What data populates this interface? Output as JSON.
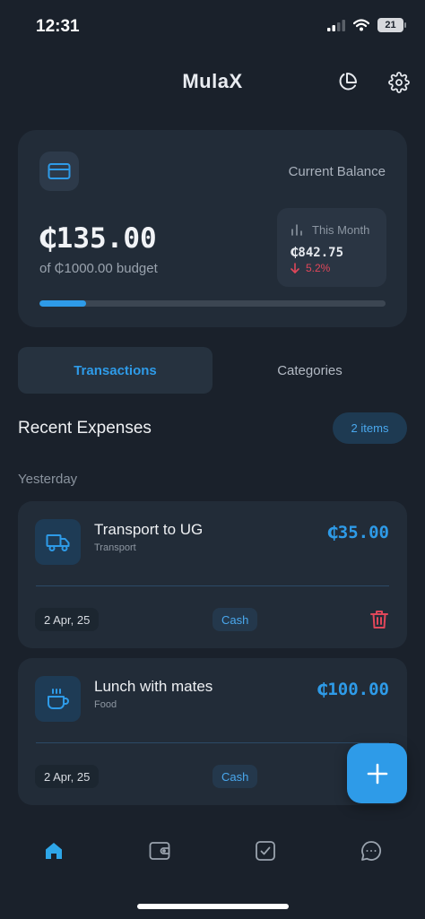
{
  "status": {
    "time": "12:31",
    "battery": "21"
  },
  "header": {
    "title": "MulaX"
  },
  "balance": {
    "label": "Current Balance",
    "amount": "₵135.00",
    "budget_text": "of ₵1000.00 budget",
    "progress_fraction": 0.135,
    "this_month_label": "This Month",
    "this_month_amount": "₵842.75",
    "this_month_change": "5.2%"
  },
  "tabs": [
    {
      "label": "Transactions",
      "active": true
    },
    {
      "label": "Categories",
      "active": false
    }
  ],
  "section": {
    "title": "Recent Expenses",
    "count": "2 items",
    "group_label": "Yesterday"
  },
  "transactions": [
    {
      "title": "Transport to UG",
      "category": "Transport",
      "amount": "₵35.00",
      "date": "2 Apr, 25",
      "method": "Cash",
      "icon": "truck-icon"
    },
    {
      "title": "Lunch with mates",
      "category": "Food",
      "amount": "₵100.00",
      "date": "2 Apr, 25",
      "method": "Cash",
      "icon": "coffee-icon"
    }
  ],
  "nav": {
    "items": [
      "home-icon",
      "wallet-icon",
      "checklist-icon",
      "chat-icon"
    ],
    "active": "home-icon"
  },
  "colors": {
    "accent": "#2e9be8",
    "negative": "#e0475a",
    "background": "#1a212b",
    "card": "#222c38"
  }
}
